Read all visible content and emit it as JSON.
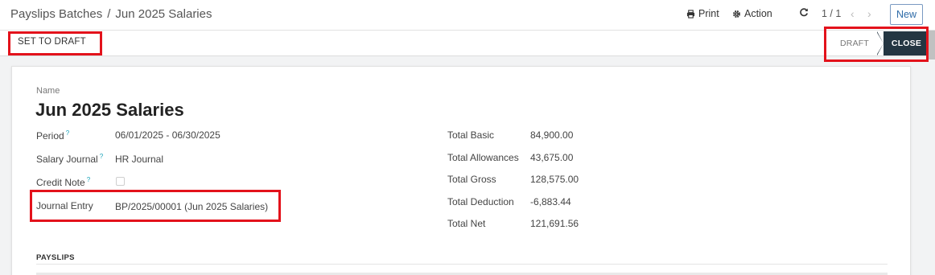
{
  "breadcrumb": {
    "parent": "Payslips Batches",
    "separator": "/",
    "current": "Jun 2025 Salaries"
  },
  "toolbar": {
    "print_label": "Print",
    "action_label": "Action",
    "new_label": "New"
  },
  "pager": {
    "value": "1 / 1"
  },
  "actions": {
    "set_to_draft_label": "SET TO DRAFT"
  },
  "statusbar": {
    "states": [
      "DRAFT",
      "CLOSE"
    ],
    "active": "CLOSE"
  },
  "form": {
    "name_label": "Name",
    "name": "Jun 2025 Salaries",
    "fields": [
      {
        "label": "Period",
        "help": "?",
        "value": "06/01/2025 - 06/30/2025"
      },
      {
        "label": "Salary Journal",
        "help": "?",
        "value": "HR Journal"
      },
      {
        "label": "Credit Note",
        "help": "?",
        "checked": false
      },
      {
        "label": "Journal Entry",
        "value": "BP/2025/00001 (Jun 2025 Salaries)"
      }
    ],
    "totals": [
      {
        "label": "Total Basic",
        "value": "84,900.00"
      },
      {
        "label": "Total Allowances",
        "value": "43,675.00"
      },
      {
        "label": "Total Gross",
        "value": "128,575.00"
      },
      {
        "label": "Total Deduction",
        "value": "-6,883.44"
      },
      {
        "label": "Total Net",
        "value": "121,691.56"
      }
    ],
    "payslips_title": "PAYSLIPS"
  },
  "colors": {
    "highlight": "#e3121b",
    "status_active": "#243642",
    "new_button": "#2f6ca8"
  }
}
